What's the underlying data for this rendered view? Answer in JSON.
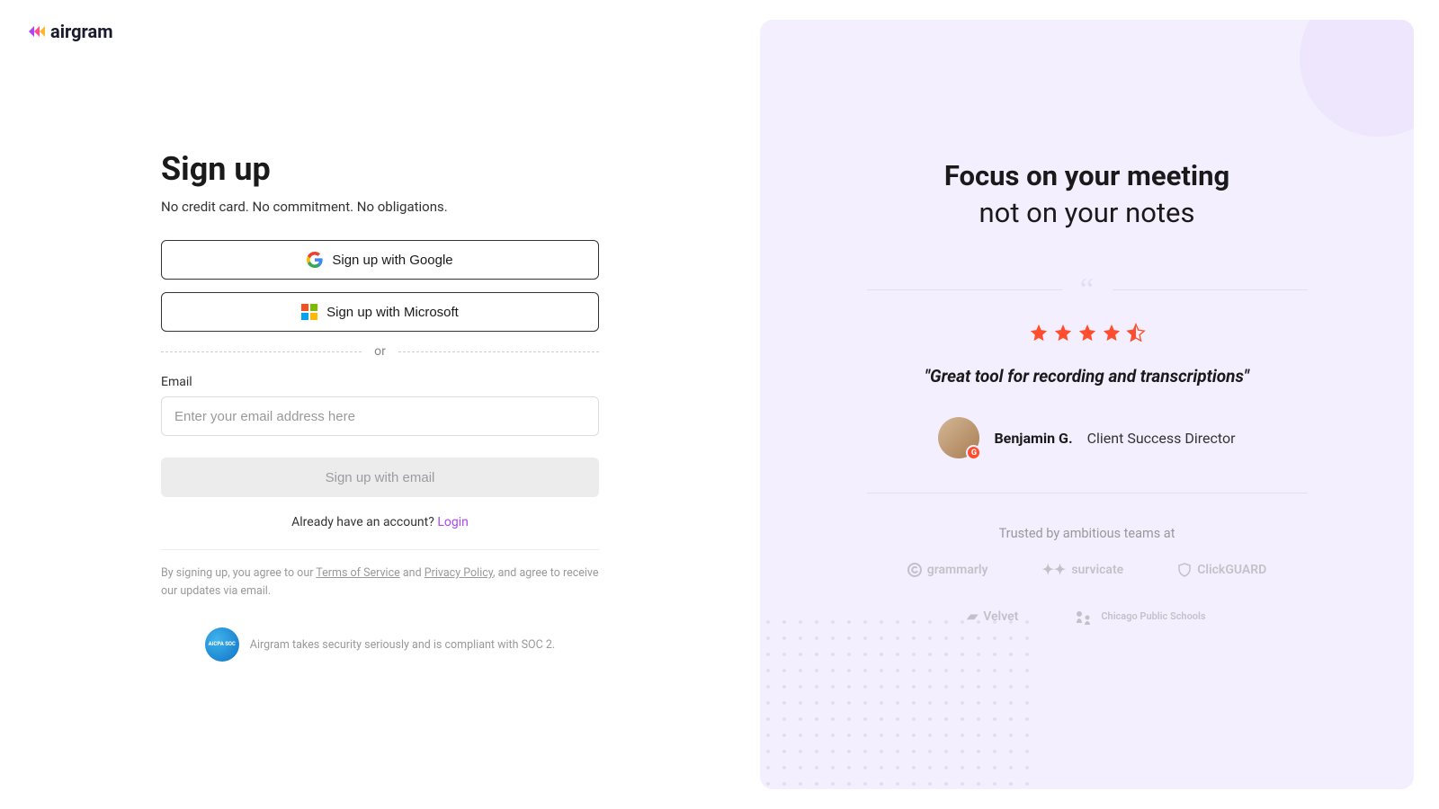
{
  "brand": {
    "name": "airgram"
  },
  "signup": {
    "title": "Sign up",
    "subtitle": "No credit card. No commitment. No obligations.",
    "google_btn": "Sign up with Google",
    "microsoft_btn": "Sign up with Microsoft",
    "divider": "or",
    "email_label": "Email",
    "email_placeholder": "Enter your email address here",
    "submit_btn": "Sign up with email",
    "login_prompt": "Already have an account? ",
    "login_link": "Login",
    "legal_prefix": "By signing up, you agree to our ",
    "tos": "Terms of Service",
    "legal_mid": " and ",
    "privacy": "Privacy Policy",
    "legal_suffix": ", and agree to receive our updates via email.",
    "soc2_text": "Airgram takes security seriously and is compliant with SOC 2.",
    "soc2_badge": "AICPA SOC"
  },
  "hero": {
    "heading_bold": "Focus on your meeting",
    "heading_light": "not on your notes",
    "rating": 4.5,
    "quote": "\"Great tool for recording and transcriptions\"",
    "author_name": "Benjamin G.",
    "author_role": "Client Success Director",
    "trusted_label": "Trusted by ambitious teams at",
    "clients": [
      "grammarly",
      "survicate",
      "ClickGUARD",
      "Velvet",
      "Chicago Public Schools"
    ]
  }
}
